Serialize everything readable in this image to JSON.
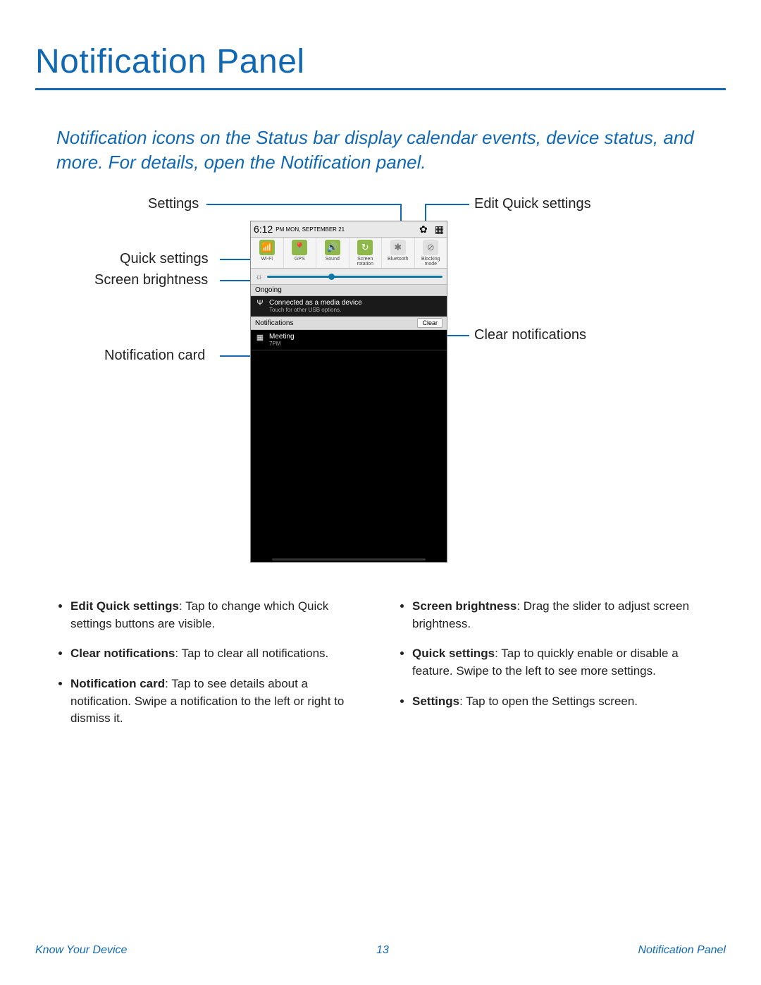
{
  "title": "Notification Panel",
  "intro": "Notification icons on the Status bar display calendar events, device status, and more. For details, open the Notification panel.",
  "callouts": {
    "settings": "Settings",
    "editQuick": "Edit Quick settings",
    "quickSettings": "Quick settings",
    "screenBrightness": "Screen brightness",
    "notificationCard": "Notification card",
    "clearNotifications": "Clear notifications"
  },
  "phone": {
    "time": "6:12",
    "ampm": "PM",
    "date": "MON, SEPTEMBER 21",
    "quick": [
      {
        "label": "Wi-Fi",
        "glyph": "📶",
        "on": true
      },
      {
        "label": "GPS",
        "glyph": "📍",
        "on": true
      },
      {
        "label": "Sound",
        "glyph": "🔊",
        "on": true
      },
      {
        "label": "Screen rotation",
        "glyph": "↻",
        "on": true
      },
      {
        "label": "Bluetooth",
        "glyph": "✱",
        "on": false
      },
      {
        "label": "Blocking mode",
        "glyph": "⊘",
        "on": false
      }
    ],
    "ongoingHeader": "Ongoing",
    "ongoing": {
      "title": "Connected as a media device",
      "sub": "Touch for other USB options."
    },
    "notificationsHeader": "Notifications",
    "clearLabel": "Clear",
    "notif": {
      "title": "Meeting",
      "sub": "7PM"
    }
  },
  "bulletsLeft": [
    {
      "b": "Edit Quick settings",
      "t": ": Tap to change which Quick settings buttons are visible."
    },
    {
      "b": "Clear notifications",
      "t": ": Tap to clear all notifications."
    },
    {
      "b": "Notification card",
      "t": ": Tap to see details about a notification. Swipe a notification to the left or right to dismiss it."
    }
  ],
  "bulletsRight": [
    {
      "b": "Screen brightness",
      "t": ": Drag the slider to adjust screen brightness."
    },
    {
      "b": "Quick settings",
      "t": ": Tap to quickly enable or disable a feature. Swipe to the left to see more settings."
    },
    {
      "b": "Settings",
      "t": ": Tap to open the Settings screen."
    }
  ],
  "footer": {
    "left": "Know Your Device",
    "page": "13",
    "right": "Notification Panel"
  }
}
